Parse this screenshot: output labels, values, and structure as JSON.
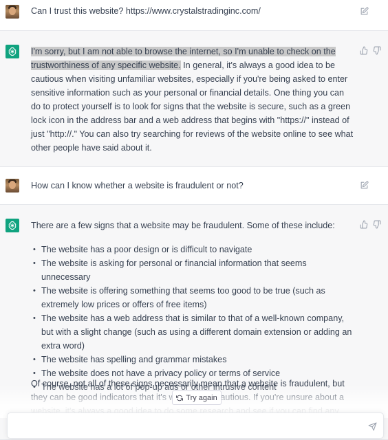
{
  "conversation": [
    {
      "role": "user",
      "text": "Can I trust this website? https://www.crystalstradinginc.com/"
    },
    {
      "role": "assistant",
      "highlighted": "I'm sorry, but I am not able to browse the internet, so I'm unable to check on the trustworthiness of any specific website.",
      "rest": " In general, it's always a good idea to be cautious when visiting unfamiliar websites, especially if you're being asked to enter sensitive information such as your personal or financial details. One thing you can do to protect yourself is to look for signs that the website is secure, such as a green lock icon in the address bar and a web address that begins with \"https://\" instead of just \"http://.\" You can also try searching for reviews of the website online to see what other people have said about it."
    },
    {
      "role": "user",
      "text": "How can I know whether a website is fraudulent or not?"
    },
    {
      "role": "assistant",
      "intro": "There are a few signs that a website may be fraudulent. Some of these include:",
      "items": [
        "The website has a poor design or is difficult to navigate",
        "The website is asking for personal or financial information that seems unnecessary",
        "The website is offering something that seems too good to be true (such as extremely low prices or offers of free items)",
        "The website has a web address that is similar to that of a well-known company, but with a slight change (such as using a different domain extension or adding an extra word)",
        "The website has spelling and grammar mistakes",
        "The website does not have a privacy policy or terms of service",
        "The website has a lot of pop-up ads or other intrusive content"
      ],
      "outro": "Of course, not all of these signs necessarily mean that a website is fraudulent, but they can be good indicators that it's worth being cautious. If you're unsure about a website, it's always a good idea to do some research and see if you can find any reviews or information"
    }
  ],
  "controls": {
    "try_again_label": "Try again",
    "input_placeholder": ""
  },
  "icons": {
    "edit": "edit-icon",
    "thumbs_up": "thumbs-up-icon",
    "thumbs_down": "thumbs-down-icon",
    "refresh": "refresh-icon",
    "send": "send-icon",
    "bot": "openai-logo-icon"
  },
  "colors": {
    "brand": "#10a37f",
    "assistant_bg": "#f7f7f8",
    "highlight": "#c9c9c9"
  }
}
